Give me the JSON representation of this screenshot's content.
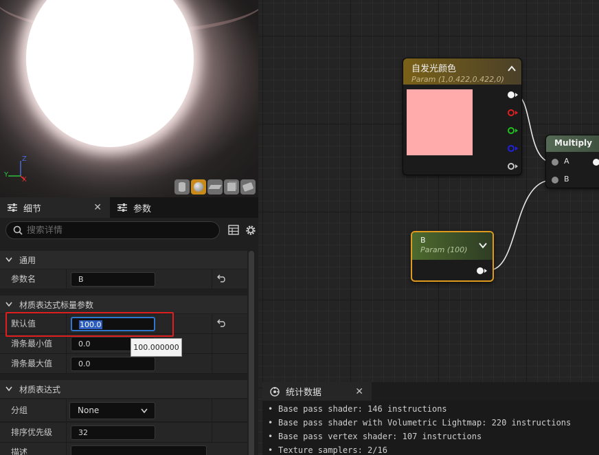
{
  "viewport": {
    "gizmo": {
      "z": "Z",
      "y": "Y",
      "x": "X"
    },
    "preview_buttons": [
      "cylinder-icon",
      "sphere-icon",
      "plane-icon",
      "cube-icon",
      "custom-mesh-icon"
    ],
    "active_preview": "sphere-icon"
  },
  "left_panel": {
    "tabs": [
      {
        "label": "细节",
        "icon": "details-sliders-icon"
      },
      {
        "label": "参数",
        "icon": "params-sliders-icon"
      }
    ],
    "search": {
      "placeholder": "搜索详情"
    },
    "sections": [
      {
        "title": "通用",
        "rows": [
          {
            "label": "参数名",
            "value": "B"
          }
        ]
      },
      {
        "title": "材质表达式标量参数",
        "rows": [
          {
            "label": "默认值",
            "value": "100.0"
          },
          {
            "label": "滑条最小值",
            "value": "0.0"
          },
          {
            "label": "滑条最大值",
            "value": "0.0"
          }
        ]
      },
      {
        "title": "材质表达式",
        "rows": [
          {
            "label": "分组",
            "value": "None"
          },
          {
            "label": "排序优先级",
            "value": "32"
          },
          {
            "label": "描述",
            "value": ""
          }
        ]
      }
    ],
    "tooltip": "100.000000"
  },
  "graph": {
    "emissive_node": {
      "title": "自发光颜色",
      "subtitle": "Param (1,0.422,0.422,0)",
      "swatch_color": "#ffabab"
    },
    "b_node": {
      "title": "B",
      "subtitle": "Param (100)"
    },
    "multiply_node": {
      "title": "Multiply",
      "input_a": "A",
      "input_b": "B"
    },
    "pin_colors": {
      "rgb": "#f4f4f4",
      "r": "#e02020",
      "g": "#20c020",
      "b": "#2020e0",
      "a": "#c8c8c8"
    }
  },
  "stats": {
    "tab_label": "统计数据",
    "lines": [
      "Base pass shader: 146 instructions",
      "Base pass shader with Volumetric Lightmap: 220 instructions",
      "Base pass vertex shader: 107 instructions",
      "Texture samplers: 2/16"
    ]
  }
}
